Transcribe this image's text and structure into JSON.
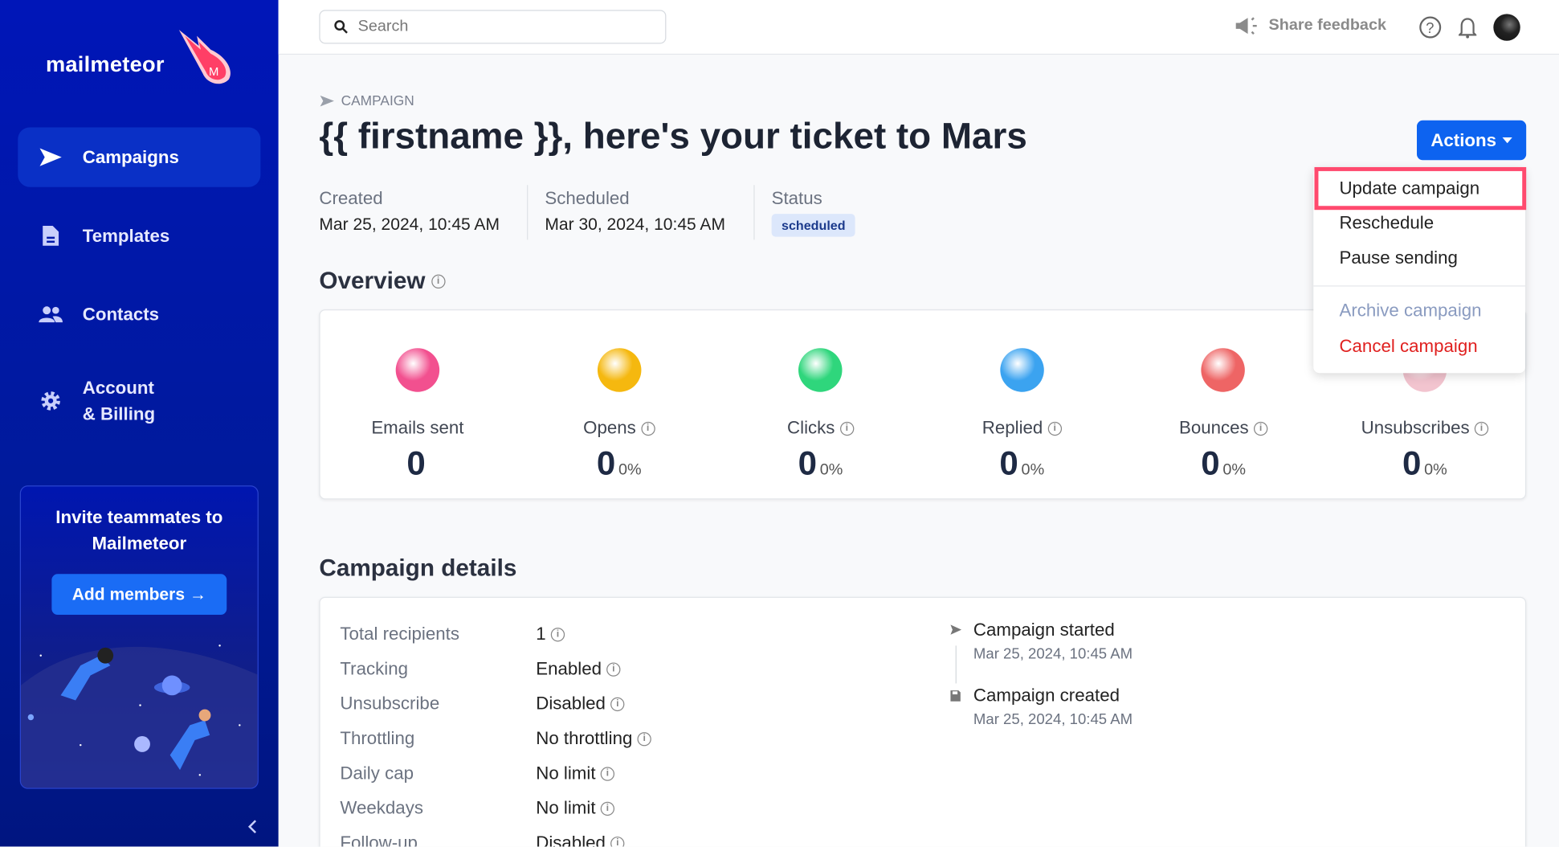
{
  "sidebar": {
    "logo": "mailmeteor",
    "items": [
      {
        "label": "Campaigns",
        "icon": "paper-plane-icon",
        "active": true
      },
      {
        "label": "Templates",
        "icon": "document-icon"
      },
      {
        "label": "Contacts",
        "icon": "users-icon"
      },
      {
        "label": "Account",
        "label2": "& Billing",
        "icon": "gear-icon"
      }
    ],
    "invite": {
      "line1": "Invite teammates to",
      "line2": "Mailmeteor",
      "button": "Add members →"
    }
  },
  "topbar": {
    "search_placeholder": "Search",
    "feedback": "Share feedback"
  },
  "page": {
    "crumb": "CAMPAIGN",
    "title": "{{ firstname }}, here's your ticket to Mars",
    "created_label": "Created",
    "created": "Mar 25, 2024, 10:45 AM",
    "scheduled_label": "Scheduled",
    "scheduled": "Mar 30, 2024, 10:45 AM",
    "status_label": "Status",
    "status": "scheduled",
    "actions": "Actions"
  },
  "menu": {
    "items": [
      "Update campaign",
      "Reschedule",
      "Pause sending",
      "Archive campaign",
      "Cancel campaign"
    ],
    "colors": {
      "archive": "#8a9bc0",
      "cancel": "#e0201f",
      "highlight": "#ff4a6e"
    }
  },
  "overview": {
    "title": "Overview",
    "stats": [
      {
        "label": "Emails sent",
        "value": "0",
        "pct": "",
        "color": "#f2508f"
      },
      {
        "label": "Opens",
        "value": "0",
        "pct": "0%",
        "color": "#f5b80f"
      },
      {
        "label": "Clicks",
        "value": "0",
        "pct": "0%",
        "color": "#2fd67c"
      },
      {
        "label": "Replied",
        "value": "0",
        "pct": "0%",
        "color": "#3ba3f0"
      },
      {
        "label": "Bounces",
        "value": "0",
        "pct": "0%",
        "color": "#ee6565"
      },
      {
        "label": "Unsubscribes",
        "value": "0",
        "pct": "0%",
        "color": "#f2c4cf"
      }
    ]
  },
  "details": {
    "title": "Campaign details",
    "rows": [
      {
        "k": "Total recipients",
        "v": "1"
      },
      {
        "k": "Tracking",
        "v": "Enabled"
      },
      {
        "k": "Unsubscribe",
        "v": "Disabled"
      },
      {
        "k": "Throttling",
        "v": "No throttling"
      },
      {
        "k": "Daily cap",
        "v": "No limit"
      },
      {
        "k": "Weekdays",
        "v": "No limit"
      },
      {
        "k": "Follow-up",
        "v": "Disabled"
      }
    ],
    "timeline": [
      {
        "t": "Campaign started",
        "d": "Mar 25, 2024, 10:45 AM"
      },
      {
        "t": "Campaign created",
        "d": "Mar 25, 2024, 10:45 AM"
      }
    ]
  }
}
